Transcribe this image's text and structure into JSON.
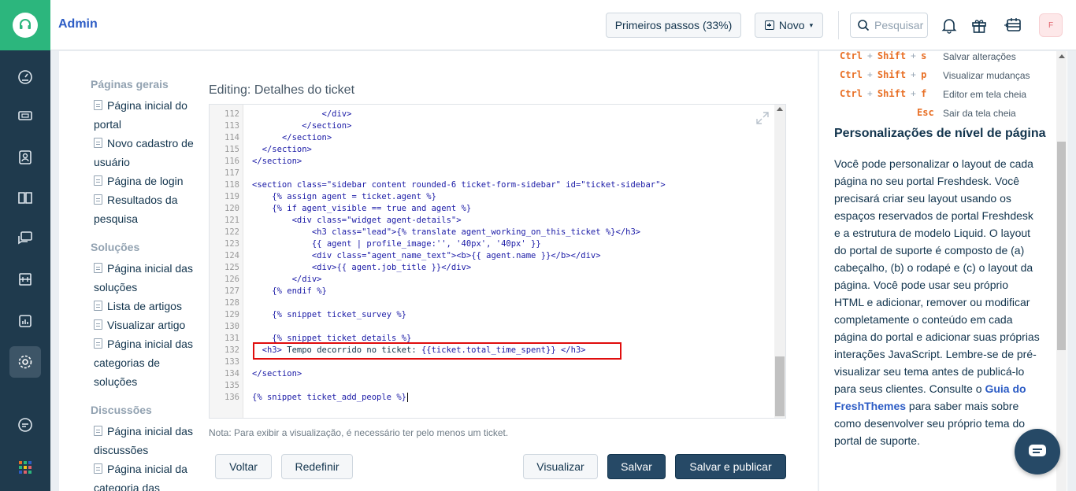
{
  "topbar": {
    "title": "Admin",
    "first_steps_label": "Primeiros passos (33%)",
    "new_label": "Novo",
    "search_placeholder": "Pesquisar",
    "avatar_initial": "F"
  },
  "sidebar_links": {
    "general_heading": "Páginas gerais",
    "general": [
      "Página inicial do portal",
      "Novo cadastro de usuário",
      "Página de login",
      "Resultados da pesquisa"
    ],
    "solutions_heading": "Soluções",
    "solutions": [
      "Página inicial das soluções",
      "Lista de artigos",
      "Visualizar artigo",
      "Página inicial das categorias de soluções"
    ],
    "discussions_heading": "Discussões",
    "discussions": [
      "Página inicial das discussões",
      "Página inicial da categoria das"
    ]
  },
  "editor": {
    "title_prefix": "Editing:",
    "title_name": "Detalhes do ticket",
    "note": "Nota: Para exibir a visualização, é necessário ter pelo menos um ticket.",
    "line_numbers": [
      "112",
      "113",
      "114",
      "115",
      "116",
      "117",
      "118",
      "119",
      "120",
      "121",
      "122",
      "123",
      "124",
      "125",
      "126",
      "127",
      "128",
      "129",
      "130",
      "131",
      "132",
      "133",
      "134",
      "135",
      "136"
    ]
  },
  "buttons": {
    "back": "Voltar",
    "reset": "Redefinir",
    "preview": "Visualizar",
    "save": "Salvar",
    "save_publish": "Salvar e publicar"
  },
  "shortcuts": [
    {
      "keys": [
        "Ctrl",
        "Shift",
        "s"
      ],
      "desc": "Salvar alterações"
    },
    {
      "keys": [
        "Ctrl",
        "Shift",
        "p"
      ],
      "desc": "Visualizar mudanças"
    },
    {
      "keys": [
        "Ctrl",
        "Shift",
        "f"
      ],
      "desc": "Editor em tela cheia"
    },
    {
      "keys": [
        "Esc"
      ],
      "desc": "Sair da tela cheia"
    }
  ],
  "right_panel": {
    "title": "Personalizações de nível de página",
    "body_before_link": "Você pode personalizar o layout de cada página no seu portal Freshdesk. Você precisará criar seu layout usando os espaços reservados de portal Freshdesk e a estrutura de modelo Liquid. O layout do portal de suporte é composto de (a) cabeçalho, (b) o rodapé e (c) o layout da página. Você pode usar seu próprio HTML e adicionar, remover ou modificar completamente o conteúdo em cada página do portal e adicionar suas próprias interações JavaScript. Lembre-se de pré-visualizar seu tema antes de publicá-lo para seus clientes. Consulte o ",
    "link_text": "Guia do FreshThemes",
    "body_after_link": " para saber mais sobre como desenvolver seu próprio tema do portal de suporte."
  },
  "icons": {
    "logo": "headset-icon",
    "nav": [
      "dashboard-icon",
      "tickets-icon",
      "contacts-icon",
      "knowledge-base-icon",
      "forums-icon",
      "groups-icon",
      "reports-icon",
      "admin-settings-icon",
      "chat-icon",
      "apps-grid-icon"
    ]
  },
  "colors": {
    "brand_green": "#2cb67d",
    "nav_bg": "#1f3a4d",
    "primary_button": "#264966",
    "highlight_border": "#e00d0d",
    "shortcut_key": "#e86f25",
    "link": "#2c5cc5"
  }
}
